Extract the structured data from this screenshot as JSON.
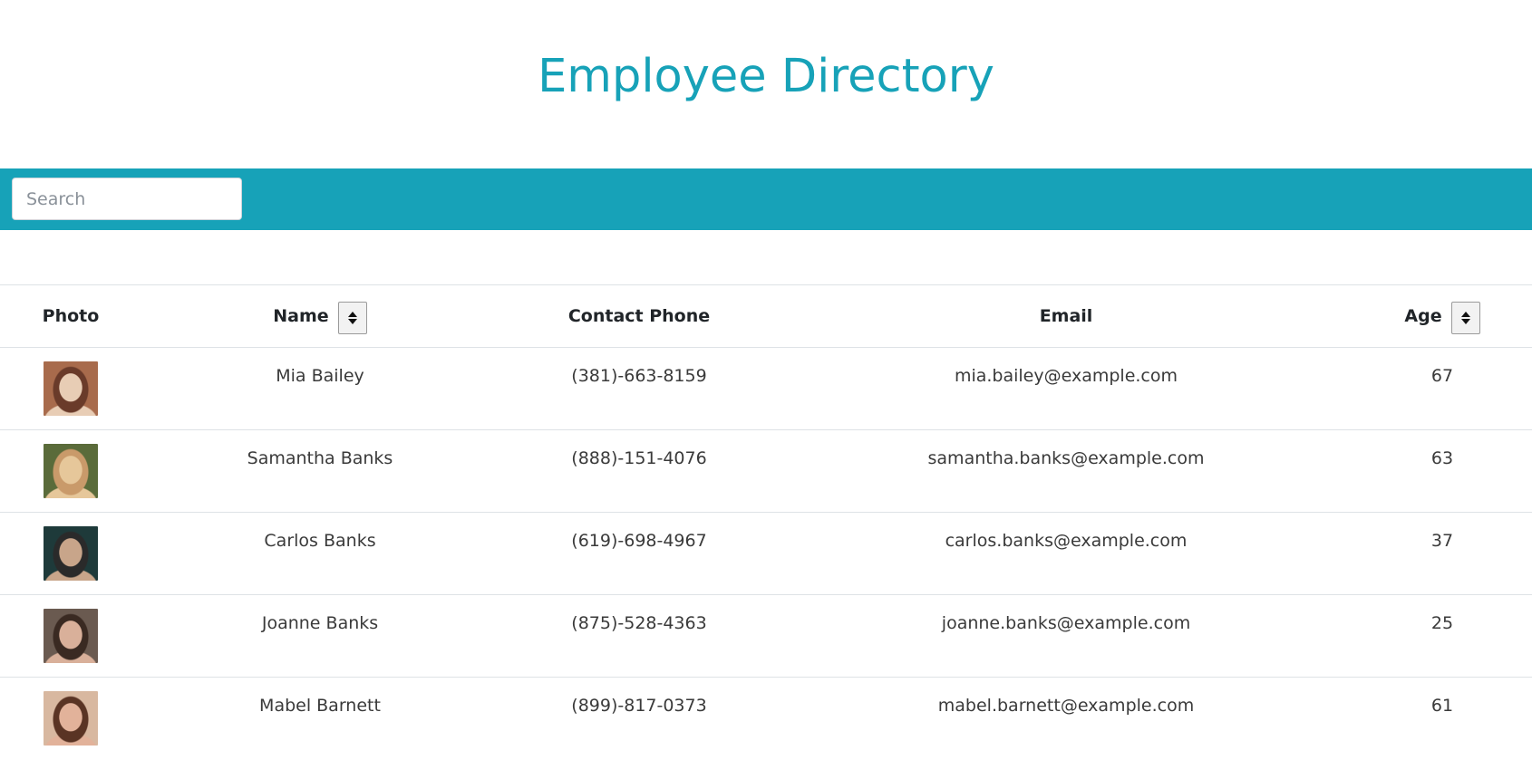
{
  "header": {
    "title": "Employee Directory",
    "accent_color": "#17a2b8"
  },
  "search": {
    "placeholder": "Search",
    "value": ""
  },
  "table": {
    "columns": {
      "photo": "Photo",
      "name": "Name",
      "phone": "Contact Phone",
      "email": "Email",
      "age": "Age"
    },
    "sort_icon": "sort-up-down-icon",
    "rows": [
      {
        "name": "Mia Bailey",
        "phone": "(381)-663-8159",
        "email": "mia.bailey@example.com",
        "age": "67",
        "photo_colors": [
          "#a86b4c",
          "#e8cdb5",
          "#6a3b2a"
        ]
      },
      {
        "name": "Samantha Banks",
        "phone": "(888)-151-4076",
        "email": "samantha.banks@example.com",
        "age": "63",
        "photo_colors": [
          "#5a6b3a",
          "#e6c79a",
          "#c99a6a"
        ]
      },
      {
        "name": "Carlos Banks",
        "phone": "(619)-698-4967",
        "email": "carlos.banks@example.com",
        "age": "37",
        "photo_colors": [
          "#1e3a3a",
          "#c8a58a",
          "#2a2a2a"
        ]
      },
      {
        "name": "Joanne Banks",
        "phone": "(875)-528-4363",
        "email": "joanne.banks@example.com",
        "age": "25",
        "photo_colors": [
          "#6a5a50",
          "#d9b09a",
          "#3a2a22"
        ]
      },
      {
        "name": "Mabel Barnett",
        "phone": "(899)-817-0373",
        "email": "mabel.barnett@example.com",
        "age": "61",
        "photo_colors": [
          "#d8b8a0",
          "#e2b29a",
          "#5a3424"
        ]
      }
    ]
  }
}
